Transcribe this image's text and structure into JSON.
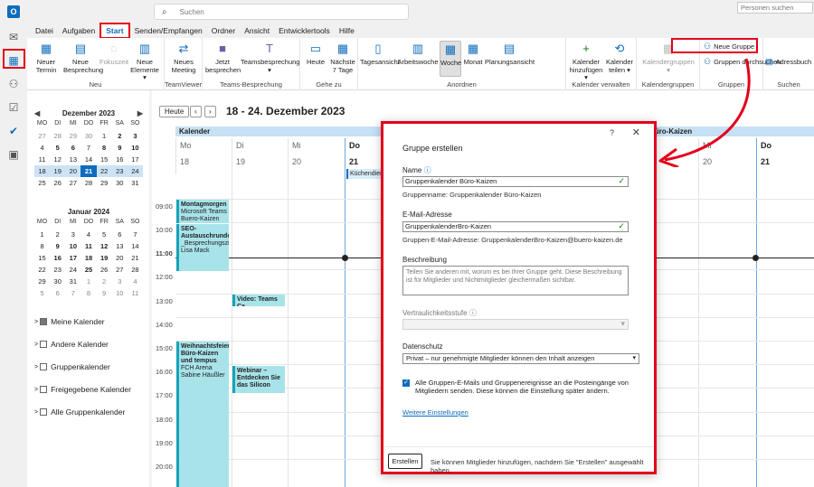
{
  "search": {
    "placeholder": "Suchen"
  },
  "app": {
    "logo": "O"
  },
  "menu": [
    "Datei",
    "Aufgaben",
    "Start",
    "Senden/Empfangen",
    "Ordner",
    "Ansicht",
    "Entwicklertools",
    "Hilfe"
  ],
  "ribbon": {
    "neuer_termin": "Neuer Termin",
    "neue_besprechung": "Neue Besprechung",
    "fokuszeit": "Fokuszeit",
    "neue_elemente": "Neue Elemente",
    "group_neu": "Neu",
    "neues_meeting": "Neues Meeting",
    "group_teamviewer": "TeamViewer",
    "jetzt_besprechen": "Jetzt besprechen",
    "teamsbesprechung": "Teamsbesprechung",
    "group_teams": "Teams-Besprechung",
    "heute": "Heute",
    "naechste_7": "Nächste 7 Tage",
    "group_gehe_zu": "Gehe zu",
    "tagesansicht": "Tagesansicht",
    "arbeitswoche": "Arbeitswoche",
    "woche": "Woche",
    "monat": "Monat",
    "planungsansicht": "Planungsansicht",
    "group_anordnen": "Anordnen",
    "kalender_hinzufuegen": "Kalender hinzufügen",
    "kalender_teilen": "Kalender teilen",
    "group_kalender_verwalten": "Kalender verwalten",
    "kalendergruppen": "Kalendergruppen",
    "group_kalendergruppen": "Kalendergruppen",
    "neue_gruppe": "Neue Gruppe",
    "gruppen_durchsuchen": "Gruppen durchsuchen",
    "group_gruppen": "Gruppen",
    "personen_suchen": "Personen suchen",
    "adressbuch": "Adressbuch",
    "group_suchen": "Suchen"
  },
  "minical": {
    "dec_title": "Dezember 2023",
    "jan_title": "Januar 2024",
    "weekdays": [
      "MO",
      "DI",
      "MI",
      "DO",
      "FR",
      "SA",
      "SO"
    ],
    "dec_days": [
      "27",
      "28",
      "29",
      "30",
      "1",
      "2",
      "3",
      "4",
      "5",
      "6",
      "7",
      "8",
      "9",
      "10",
      "11",
      "12",
      "13",
      "14",
      "15",
      "16",
      "17",
      "18",
      "19",
      "20",
      "21",
      "22",
      "23",
      "24",
      "25",
      "26",
      "27",
      "28",
      "29",
      "30",
      "31"
    ],
    "jan_days": [
      "1",
      "2",
      "3",
      "4",
      "5",
      "6",
      "7",
      "8",
      "9",
      "10",
      "11",
      "12",
      "13",
      "14",
      "15",
      "16",
      "17",
      "18",
      "19",
      "20",
      "21",
      "22",
      "23",
      "24",
      "25",
      "26",
      "27",
      "28",
      "29",
      "30",
      "31",
      "1",
      "2",
      "3",
      "4",
      "5",
      "6",
      "7",
      "8",
      "9",
      "10",
      "11"
    ]
  },
  "folders": [
    "Meine Kalender",
    "Andere Kalender",
    "Gruppenkalender",
    "Freigegebene Kalender",
    "Alle Gruppenkalender"
  ],
  "calendar": {
    "today_button": "Heute",
    "range_title": "18 - 24. Dezember 2023",
    "header_left": "Kalender",
    "header_right": "Büro-Kaizen",
    "days": [
      {
        "name": "Mo",
        "date": "18"
      },
      {
        "name": "Di",
        "date": "19"
      },
      {
        "name": "Mi",
        "date": "20"
      },
      {
        "name": "Do",
        "date": "21"
      }
    ],
    "right_days": [
      {
        "name": "Mi",
        "date": "20"
      },
      {
        "name": "Do",
        "date": "21"
      }
    ],
    "right_partial_date": "9",
    "allday_event": "Küchendienst",
    "hours": [
      "09:00",
      "10:00",
      "11:00",
      "12:00",
      "13:00",
      "14:00",
      "15:00",
      "16:00",
      "17:00",
      "18:00",
      "19:00",
      "20:00"
    ],
    "events": [
      {
        "title": "Montagmorgen",
        "line2": "Microsoft Teams",
        "line3": "Buero-Kaizen"
      },
      {
        "title": "SEO-Austauschrunde",
        "line2": "_Besprechungszimmer",
        "line3": "Lisa Mack"
      },
      {
        "title": "Video: Teams Ca",
        "line2": "",
        "line3": ""
      },
      {
        "title": "Weihnachtsfeier Büro-Kaizen und tempus",
        "line2": "FCH Arena",
        "line3": "Sabine Häußler"
      },
      {
        "title": "Webinar – Entdecken Sie das Silicon",
        "line2": "",
        "line3": ""
      }
    ]
  },
  "dialog": {
    "help": "?",
    "close": "✕",
    "title": "Gruppe erstellen",
    "name_label": "Name",
    "name_value": "Gruppenkalender Büro-Kaizen",
    "name_hint": "Gruppenname: Gruppenkalender Büro-Kaizen",
    "email_label": "E-Mail-Adresse",
    "email_value": "GruppenkalenderBro-Kaizen",
    "email_hint": "Gruppen-E-Mail-Adresse: GruppenkalenderBro-Kaizen@buero-kaizen.de",
    "desc_label": "Beschreibung",
    "desc_placeholder": "Teilen Sie anderen mit, worum es bei Ihrer Gruppe geht. Diese Beschreibung ist für Mitglieder und Nichtmitglieder gleichermaßen sichtbar.",
    "conf_label": "Vertraulichkeitsstufe",
    "privacy_label": "Datenschutz",
    "privacy_value": "Privat – nur genehmigte Mitglieder können den Inhalt anzeigen",
    "checkbox_text": "Alle Gruppen-E-Mails und Gruppenereignisse an die Posteingänge von Mitgliedern senden. Diese können die Einstellung später ändern.",
    "more_settings": "Weitere Einstellungen",
    "create_button": "Erstellen",
    "footer_text": "Sie können Mitglieder hinzufügen, nachdem Sie \"Erstellen\" ausgewählt haben."
  },
  "colors": {
    "accent": "#0f6cbd",
    "highlight": "#e3001b",
    "event": "#a8e3ea"
  }
}
